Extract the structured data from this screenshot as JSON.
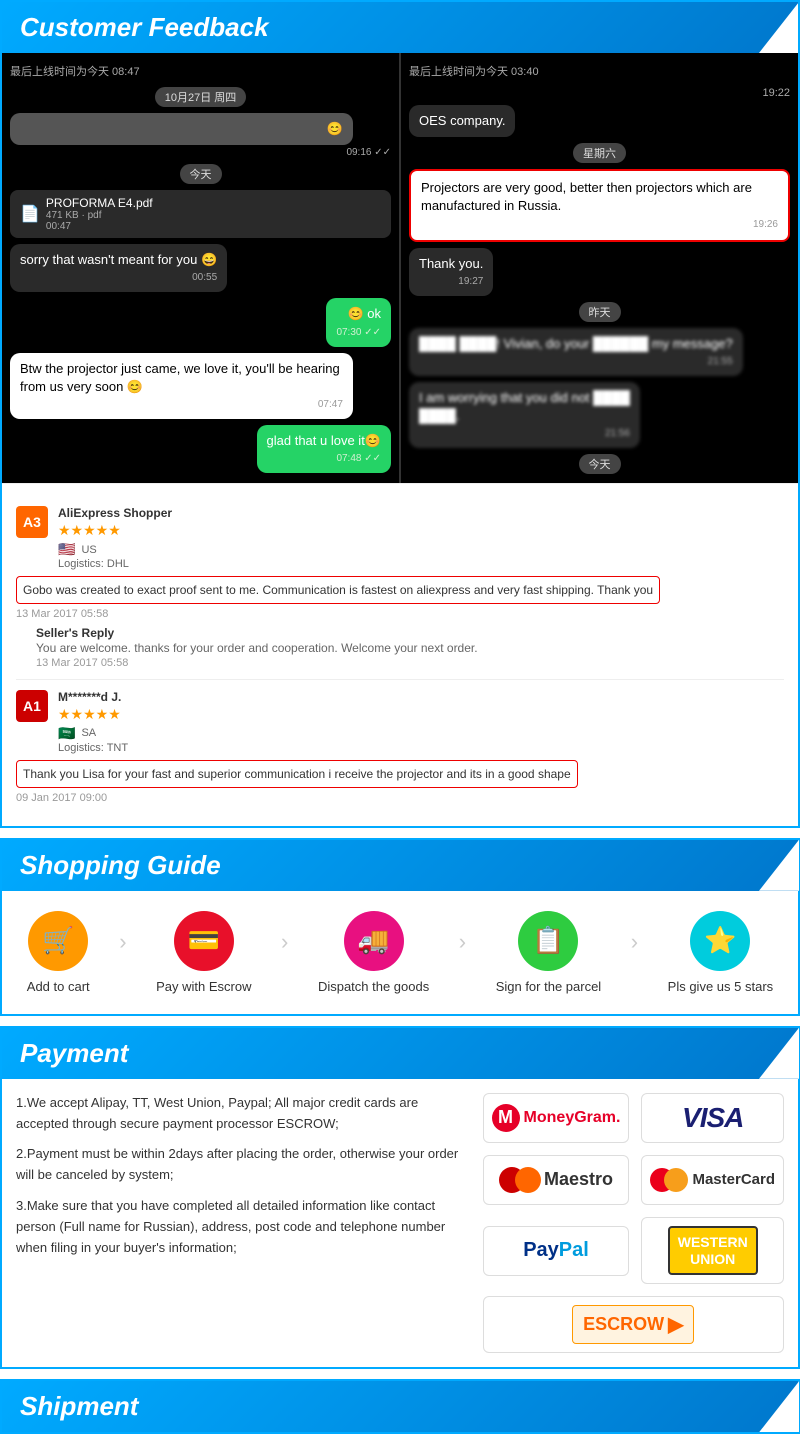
{
  "customerFeedback": {
    "title": "Customer Feedback",
    "chat": {
      "left": {
        "meta": "最后上线时间为今天 08:47",
        "date1": "10月27日 周四",
        "time1": "09:16 ✓✓",
        "today": "今天",
        "file": "PROFORMA E4.pdf",
        "fileSize": "471 KB · pdf",
        "fileTime": "00:47",
        "msg1": "sorry that wasn't meant for you 😄",
        "msg1_time": "00:55",
        "msg2": "😊 ok",
        "msg2_time": "07:30 ✓✓",
        "msg3": "Btw the projector just came, we love it, you'll be hearing from us very soon 😊",
        "msg3_time": "07:47",
        "msg4": "glad that u love it😊",
        "msg4_time": "07:48 ✓✓"
      },
      "right": {
        "meta": "最后上线时间为今天 03:40",
        "time1": "19:22",
        "company": "OES company.",
        "weekday": "星期六",
        "msg1": "Projectors are very good, better then projectors which are manufactured in Russia.",
        "msg1_time": "19:26",
        "thanks": "Thank you.",
        "thanks_time": "19:27",
        "yesterday": "昨天",
        "blurred1": "████ ████! ██████, ██ ████ ██████",
        "blurred1_note": "my message?",
        "time2": "21:55",
        "blurred2": "I am worrying that you did not ████",
        "blurred2_cont": "████.",
        "time3": "21:56",
        "today": "今天"
      }
    },
    "reviews": [
      {
        "avatar": "A3",
        "avatarClass": "avatar-orange",
        "name": "AliExpress Shopper",
        "country": "🇺🇸",
        "countryCode": "US",
        "stars": 5,
        "logistics": "Logistics: DHL",
        "text": "Gobo was created to exact proof sent to me. Communication is fastest on aliexpress and very fast shipping. Thank you",
        "date": "13 Mar 2017 05:58",
        "sellerReply": {
          "label": "Seller's Reply",
          "text": "You are welcome. thanks for your order and cooperation. Welcome your next order.",
          "date": "13 Mar 2017 05:58"
        }
      },
      {
        "avatar": "A1",
        "avatarClass": "avatar-red",
        "name": "M*******d J.",
        "country": "🇸🇦",
        "countryCode": "SA",
        "stars": 5,
        "logistics": "Logistics: TNT",
        "text": "Thank you Lisa for your fast and superior communication i receive the projector and its in a good shape",
        "date": "09 Jan 2017 09:00"
      }
    ]
  },
  "shoppingGuide": {
    "title": "Shopping Guide",
    "steps": [
      {
        "id": "add-to-cart",
        "icon": "🛒",
        "iconClass": "icon-orange",
        "label": "Add to cart"
      },
      {
        "id": "pay-escrow",
        "icon": "💳",
        "iconClass": "icon-red",
        "label": "Pay with Escrow"
      },
      {
        "id": "dispatch",
        "icon": "🚚",
        "iconClass": "icon-pink",
        "label": "Dispatch the goods"
      },
      {
        "id": "sign-parcel",
        "icon": "📋",
        "iconClass": "icon-green",
        "label": "Sign for the parcel"
      },
      {
        "id": "five-stars",
        "icon": "⭐",
        "iconClass": "icon-cyan",
        "label": "Pls give us 5 stars"
      }
    ]
  },
  "payment": {
    "title": "Payment",
    "points": [
      "1.We accept Alipay, TT, West Union, Paypal; All major credit cards are accepted through secure payment processor ESCROW;",
      "2.Payment must be within 2days after placing the order, otherwise your order will be canceled by system;",
      "3.Make sure that you have completed all detailed information like contact person (Full name for Russian), address, post code and telephone number when filing in your buyer's information;"
    ],
    "logos": [
      {
        "id": "moneygram",
        "label": "MoneyGram."
      },
      {
        "id": "visa",
        "label": "VISA"
      },
      {
        "id": "maestro",
        "label": "Maestro"
      },
      {
        "id": "mastercard",
        "label": "MasterCard"
      },
      {
        "id": "paypal",
        "label": "PayPal"
      },
      {
        "id": "westernunion",
        "label": "WESTERN\nUNION"
      },
      {
        "id": "escrow",
        "label": "ESCROW"
      }
    ]
  },
  "shipment": {
    "title": "Shipment"
  }
}
